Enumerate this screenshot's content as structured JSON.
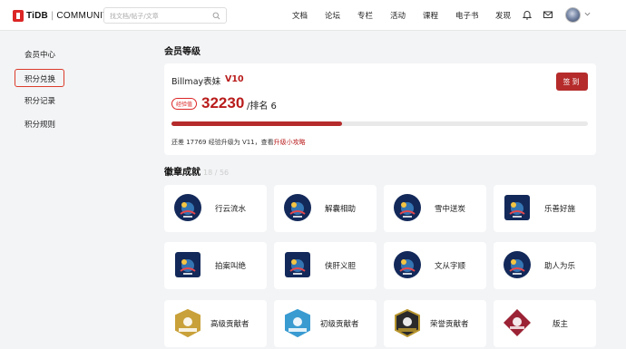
{
  "header": {
    "logo_brand": "TiDB",
    "logo_sep": "|",
    "logo_community": "COMMUNITY",
    "search_placeholder": "找文档/帖子/文章",
    "nav": [
      "文档",
      "论坛",
      "专栏",
      "活动",
      "课程",
      "电子书",
      "发现"
    ],
    "icons": [
      "bell-icon",
      "mail-icon",
      "avatar",
      "chevron-down-icon"
    ]
  },
  "sidebar": {
    "items": [
      "会员中心",
      "积分兑换",
      "积分记录",
      "积分规则"
    ],
    "active_index": 1
  },
  "level": {
    "title": "会员等级",
    "username": "Billmay表妹",
    "level": "V10",
    "sign_label": "签到",
    "xp_label": "经验值",
    "xp_value": "32230",
    "rank": "/排名 6",
    "progress_fraction": 0.41,
    "hint_text": "还差 17769 经验升级为 V11，查看",
    "hint_link": "升级小攻略"
  },
  "badges": {
    "title": "徽章成就",
    "count": "18 / 56",
    "items": [
      {
        "name": "行云流水",
        "icon": "badge-wave-icon"
      },
      {
        "name": "解囊相助",
        "icon": "badge-gift-icon"
      },
      {
        "name": "雪中送炭",
        "icon": "badge-snow-icon"
      },
      {
        "name": "乐善好施",
        "icon": "badge-charity-icon"
      },
      {
        "name": "拍案叫绝",
        "icon": "badge-applause-icon"
      },
      {
        "name": "侠肝义胆",
        "icon": "badge-hero-icon"
      },
      {
        "name": "文从字顺",
        "icon": "badge-writing-icon"
      },
      {
        "name": "助人为乐",
        "icon": "badge-helper-icon"
      },
      {
        "name": "高级贡献者",
        "icon": "badge-senior-shield-icon"
      },
      {
        "name": "初级贡献者",
        "icon": "badge-junior-shield-icon"
      },
      {
        "name": "荣誉贡献者",
        "icon": "badge-premium-shield-icon"
      },
      {
        "name": "版主",
        "icon": "badge-moderator-icon"
      }
    ]
  },
  "colors": {
    "accent": "#b52b2b",
    "accent_text": "#b91c1c",
    "page_bg": "#f3f4f6"
  }
}
